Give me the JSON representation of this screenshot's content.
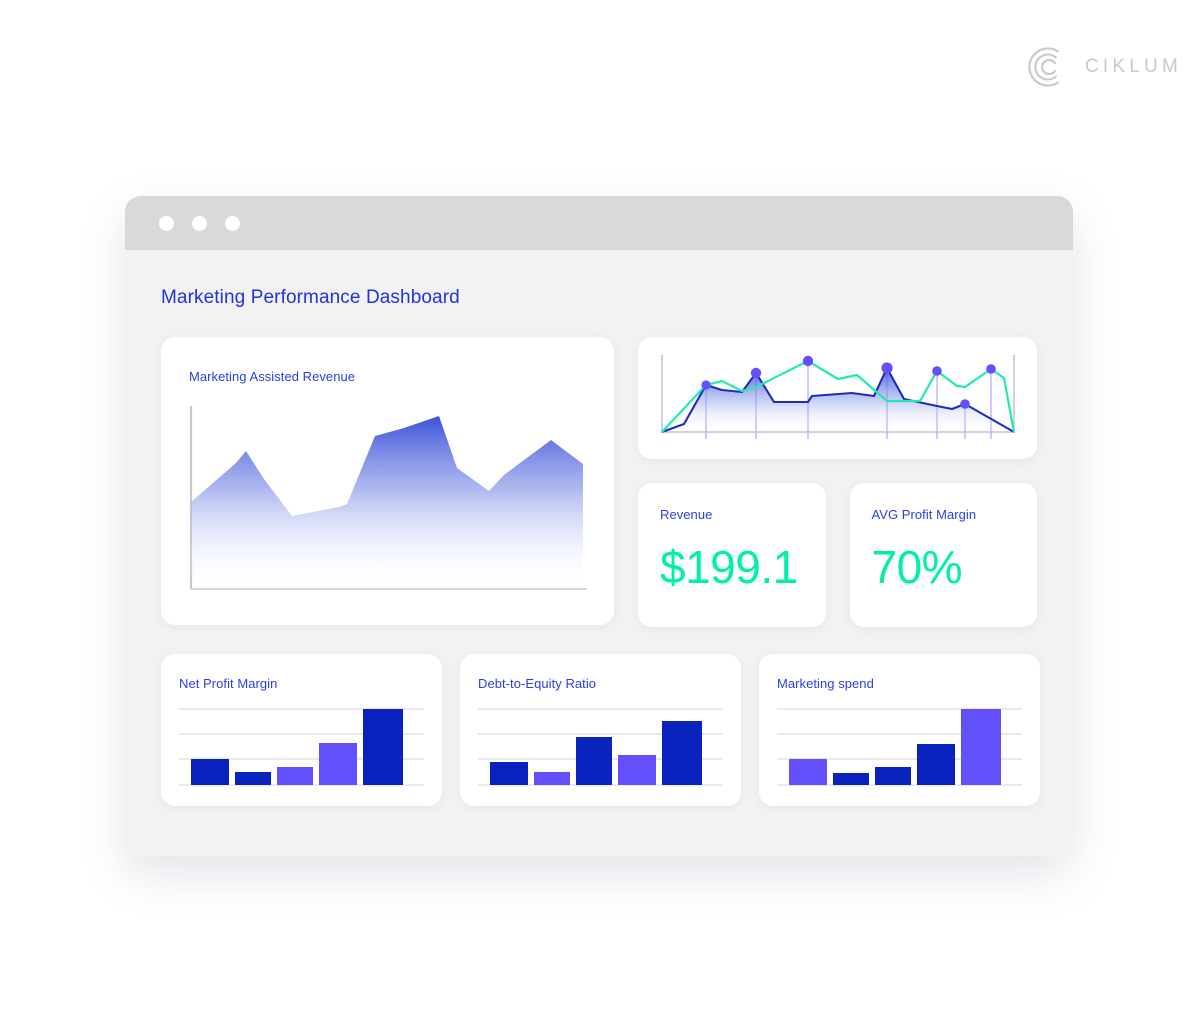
{
  "brand": {
    "name": "CIKLUM",
    "logo_color": "#c9c9cd"
  },
  "window": {
    "dots": [
      "window-dot-1",
      "window-dot-2",
      "window-dot-3"
    ],
    "title": "Marketing Performance Dashboard"
  },
  "colors": {
    "accent_blue": "#2233dd",
    "title_blue": "#2b3fe0",
    "dark_blue": "#0a22be",
    "purple": "#6450fb",
    "teal": "#00f0ac",
    "card_bg": "#ffffff",
    "window_bg": "#f2f2f3",
    "titlebar_bg": "#d9d9db",
    "gridline": "#d6d6dc"
  },
  "cards": {
    "area": {
      "title": "Marketing Assisted Revenue"
    },
    "lines": {
      "title": ""
    },
    "kpi_revenue": {
      "title": "Revenue",
      "value": "$199.1"
    },
    "kpi_margin": {
      "title": "AVG Profit Margin",
      "value": "70%"
    },
    "bars_net_profit": {
      "title": "Net Profit Margin"
    },
    "bars_debt_equity": {
      "title": "Debt-to-Equity Ratio"
    },
    "bars_marketing_spend": {
      "title": "Marketing spend"
    }
  },
  "chart_data": [
    {
      "id": "marketing-assisted-revenue",
      "type": "area",
      "title": "Marketing Assisted Revenue",
      "xlabel": "",
      "ylabel": "",
      "grid": false,
      "legend": null,
      "axis_lines": [
        "left",
        "bottom"
      ],
      "fill": "gradient vertical #3d52d8 -> #ffffff",
      "x": [
        0,
        1,
        2,
        3,
        4,
        5,
        6,
        7,
        8,
        9,
        10,
        11,
        12,
        13
      ],
      "values": [
        47,
        62,
        76,
        60,
        40,
        44,
        46,
        80,
        89,
        96,
        72,
        59,
        66,
        84,
        77
      ],
      "ylim": [
        0,
        100
      ]
    },
    {
      "id": "dual-line-overview",
      "type": "line",
      "title": "",
      "xlabel": "",
      "ylabel": "",
      "grid": false,
      "axis_lines": [
        "left",
        "bottom",
        "right"
      ],
      "markers": {
        "color": "#6450fb",
        "radius": 5,
        "with_vertical_guides": true
      },
      "x": [
        0,
        1,
        2,
        3,
        4,
        5,
        6,
        7,
        8,
        9,
        10,
        11,
        12,
        13,
        14,
        15,
        16
      ],
      "series": [
        {
          "name": "Primary (dark blue, filled)",
          "color": "#1a2dbb",
          "fill": "gradient vertical #3d52d8 -> #ffffff",
          "values": [
            0,
            8,
            48,
            43,
            42,
            38,
            68,
            32,
            31,
            30,
            41,
            38,
            78,
            32,
            27,
            23,
            0
          ],
          "marker_points": [
            2,
            6,
            12,
            15
          ]
        },
        {
          "name": "Secondary (teal)",
          "color": "#20eab2",
          "fill": null,
          "values": [
            0,
            20,
            47,
            41,
            40,
            45,
            56,
            70,
            84,
            60,
            62,
            38,
            38,
            56,
            68,
            45,
            0
          ],
          "marker_points": [
            2,
            6,
            8,
            12,
            14
          ]
        }
      ],
      "ylim": [
        0,
        100
      ]
    },
    {
      "id": "net-profit-margin",
      "type": "bar",
      "title": "Net Profit Margin",
      "xlabel": "",
      "ylabel": "",
      "grid": true,
      "gridlines": 4,
      "categories": [
        "1",
        "2",
        "3",
        "4",
        "5"
      ],
      "values": [
        30,
        16,
        22,
        52,
        100
      ],
      "bar_colors": [
        "#0a22be",
        "#0a22be",
        "#6450fb",
        "#6450fb",
        "#0a22be"
      ],
      "ylim": [
        0,
        100
      ]
    },
    {
      "id": "debt-to-equity-ratio",
      "type": "bar",
      "title": "Debt-to-Equity Ratio",
      "xlabel": "",
      "ylabel": "",
      "grid": true,
      "gridlines": 4,
      "categories": [
        "1",
        "2",
        "3",
        "4",
        "5"
      ],
      "values": [
        27,
        16,
        57,
        35,
        85
      ],
      "bar_colors": [
        "#0a22be",
        "#6450fb",
        "#0a22be",
        "#6450fb",
        "#0a22be"
      ],
      "ylim": [
        0,
        100
      ]
    },
    {
      "id": "marketing-spend",
      "type": "bar",
      "title": "Marketing spend",
      "xlabel": "",
      "ylabel": "",
      "grid": true,
      "gridlines": 4,
      "categories": [
        "1",
        "2",
        "3",
        "4",
        "5"
      ],
      "values": [
        30,
        15,
        22,
        50,
        100
      ],
      "bar_colors": [
        "#6450fb",
        "#0a22be",
        "#0a22be",
        "#0a22be",
        "#6450fb"
      ],
      "ylim": [
        0,
        100
      ]
    }
  ]
}
